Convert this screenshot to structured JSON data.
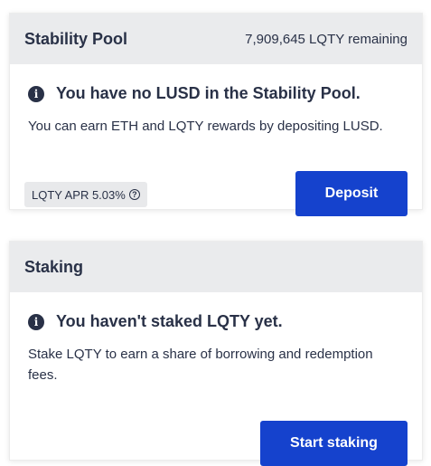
{
  "stability_pool": {
    "title": "Stability Pool",
    "remaining": "7,909,645 LQTY remaining",
    "notice_title": "You have no LUSD in the Stability Pool.",
    "description": "You can earn ETH and LQTY rewards by depositing LUSD.",
    "apr_label": "LQTY APR 5.03%",
    "deposit_label": "Deposit"
  },
  "staking": {
    "title": "Staking",
    "notice_title": "You haven't staked LQTY yet.",
    "description": "Stake LQTY to earn a share of borrowing and redemption fees.",
    "start_label": "Start staking"
  },
  "icons": {
    "info": "info-circle-icon",
    "help": "question-circle-icon"
  },
  "colors": {
    "primary_button": "#1542cd",
    "header_bg": "#eaebed",
    "text": "#293147",
    "badge_bg": "#e8e9eb"
  }
}
